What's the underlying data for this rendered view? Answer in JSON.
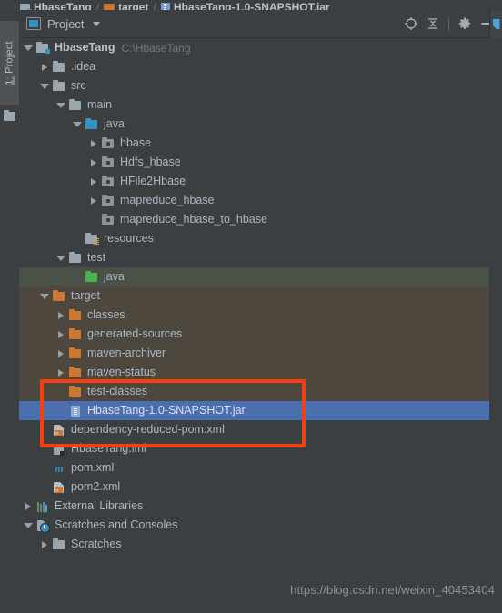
{
  "breadcrumb": {
    "items": [
      {
        "label": "HbaseTang",
        "icon": "module-icon",
        "bold": true
      },
      {
        "label": "target",
        "icon": "folder-orange-icon",
        "bold": true
      },
      {
        "label": "HbaseTang-1.0-SNAPSHOT.jar",
        "icon": "jar-icon",
        "bold": true
      }
    ],
    "separator": "/"
  },
  "tool_strip": {
    "number": "1:",
    "label": "Project",
    "full_label": "1: Project",
    "folder_icon": "folder-icon"
  },
  "tool_window": {
    "title": "Project",
    "title_icon": "project-view-icon",
    "dropdown_icon": "chevron-down-icon",
    "actions": [
      {
        "name": "locate-icon",
        "tooltip": "Select Opened File"
      },
      {
        "name": "collapse-all-icon",
        "tooltip": "Collapse All"
      },
      {
        "name": "gear-icon",
        "tooltip": "Settings"
      },
      {
        "name": "minimize-icon",
        "tooltip": "Hide"
      }
    ]
  },
  "colors": {
    "background": "#3c3f41",
    "selection": "#4b6eaf",
    "excluded_row": "#4d473e",
    "test_source_row": "#4a5248",
    "annotation": "#f44010",
    "text": "#a9b7c6",
    "muted_text": "#787878"
  },
  "tree": {
    "rows": [
      {
        "label": "HbaseTang",
        "sub": "C:\\HbaseTang",
        "depth": 0,
        "arrow": "down",
        "icon": "module-folder-icon",
        "bold": true,
        "state": "normal",
        "name": "tree-node-hbasetang"
      },
      {
        "label": ".idea",
        "depth": 1,
        "arrow": "right",
        "icon": "folder-grey-icon",
        "state": "normal",
        "name": "tree-node-idea"
      },
      {
        "label": "src",
        "depth": 1,
        "arrow": "down",
        "icon": "folder-grey-icon",
        "state": "normal",
        "name": "tree-node-src"
      },
      {
        "label": "main",
        "depth": 2,
        "arrow": "down",
        "icon": "folder-grey-icon",
        "state": "normal",
        "name": "tree-node-main"
      },
      {
        "label": "java",
        "depth": 3,
        "arrow": "down",
        "icon": "source-root-icon",
        "state": "normal",
        "name": "tree-node-main-java"
      },
      {
        "label": "hbase",
        "depth": 4,
        "arrow": "right",
        "icon": "package-icon",
        "state": "normal",
        "name": "tree-node-hbase"
      },
      {
        "label": "Hdfs_hbase",
        "depth": 4,
        "arrow": "right",
        "icon": "package-icon",
        "state": "normal",
        "name": "tree-node-hdfs-hbase"
      },
      {
        "label": "HFile2Hbase",
        "depth": 4,
        "arrow": "right",
        "icon": "package-icon",
        "state": "normal",
        "name": "tree-node-hfile2hbase"
      },
      {
        "label": "mapreduce_hbase",
        "depth": 4,
        "arrow": "right",
        "icon": "package-icon",
        "state": "normal",
        "name": "tree-node-mapreduce-hbase"
      },
      {
        "label": "mapreduce_hbase_to_hbase",
        "depth": 4,
        "arrow": "none",
        "icon": "package-icon",
        "state": "normal",
        "name": "tree-node-mapreduce-hbase-to-hbase"
      },
      {
        "label": "resources",
        "depth": 3,
        "arrow": "none",
        "icon": "resources-root-icon",
        "state": "normal",
        "name": "tree-node-resources"
      },
      {
        "label": "test",
        "depth": 2,
        "arrow": "down",
        "icon": "folder-grey-icon",
        "state": "normal",
        "name": "tree-node-test"
      },
      {
        "label": "java",
        "depth": 3,
        "arrow": "none",
        "icon": "test-source-root-icon",
        "state": "test",
        "name": "tree-node-test-java"
      },
      {
        "label": "target",
        "depth": 1,
        "arrow": "down",
        "icon": "folder-orange-icon",
        "state": "excluded",
        "name": "tree-node-target"
      },
      {
        "label": "classes",
        "depth": 2,
        "arrow": "right",
        "icon": "folder-orange-icon",
        "state": "excluded",
        "name": "tree-node-classes"
      },
      {
        "label": "generated-sources",
        "depth": 2,
        "arrow": "right",
        "icon": "folder-orange-icon",
        "state": "excluded",
        "name": "tree-node-generated-sources"
      },
      {
        "label": "maven-archiver",
        "depth": 2,
        "arrow": "right",
        "icon": "folder-orange-icon",
        "state": "excluded",
        "name": "tree-node-maven-archiver"
      },
      {
        "label": "maven-status",
        "depth": 2,
        "arrow": "right",
        "icon": "folder-orange-icon",
        "state": "excluded",
        "name": "tree-node-maven-status"
      },
      {
        "label": "test-classes",
        "depth": 2,
        "arrow": "none",
        "icon": "folder-orange-icon",
        "state": "excluded",
        "name": "tree-node-test-classes"
      },
      {
        "label": "HbaseTang-1.0-SNAPSHOT.jar",
        "depth": 2,
        "arrow": "none",
        "icon": "jar-icon",
        "state": "selected",
        "name": "tree-node-hbasetang-jar"
      },
      {
        "label": "dependency-reduced-pom.xml",
        "depth": 1,
        "arrow": "none",
        "icon": "xml-file-icon",
        "state": "normal",
        "name": "tree-node-dependency-reduced-pom"
      },
      {
        "label": "HbaseTang.iml",
        "depth": 1,
        "arrow": "none",
        "icon": "iml-file-icon",
        "state": "normal",
        "name": "tree-node-hbasetang-iml"
      },
      {
        "label": "pom.xml",
        "depth": 1,
        "arrow": "none",
        "icon": "maven-pom-icon",
        "state": "normal",
        "name": "tree-node-pom-xml"
      },
      {
        "label": "pom2.xml",
        "depth": 1,
        "arrow": "none",
        "icon": "xml-file-icon",
        "state": "normal",
        "name": "tree-node-pom2-xml"
      },
      {
        "label": "External Libraries",
        "depth": 0,
        "arrow": "right",
        "icon": "libraries-icon",
        "state": "normal",
        "name": "tree-node-external-libraries"
      },
      {
        "label": "Scratches and Consoles",
        "depth": 0,
        "arrow": "down",
        "icon": "scratches-icon",
        "state": "normal",
        "name": "tree-node-scratches-and-consoles"
      },
      {
        "label": "Scratches",
        "depth": 1,
        "arrow": "right",
        "icon": "folder-grey-icon",
        "state": "normal",
        "name": "tree-node-scratches"
      }
    ]
  },
  "annotation": {
    "shape": "rectangle",
    "color": "#f44010",
    "encloses": [
      "test-classes",
      "HbaseTang-1.0-SNAPSHOT.jar",
      "dependency-reduced-pom.xml"
    ]
  },
  "watermark": {
    "text": "https://blog.csdn.net/weixin_40453404"
  }
}
